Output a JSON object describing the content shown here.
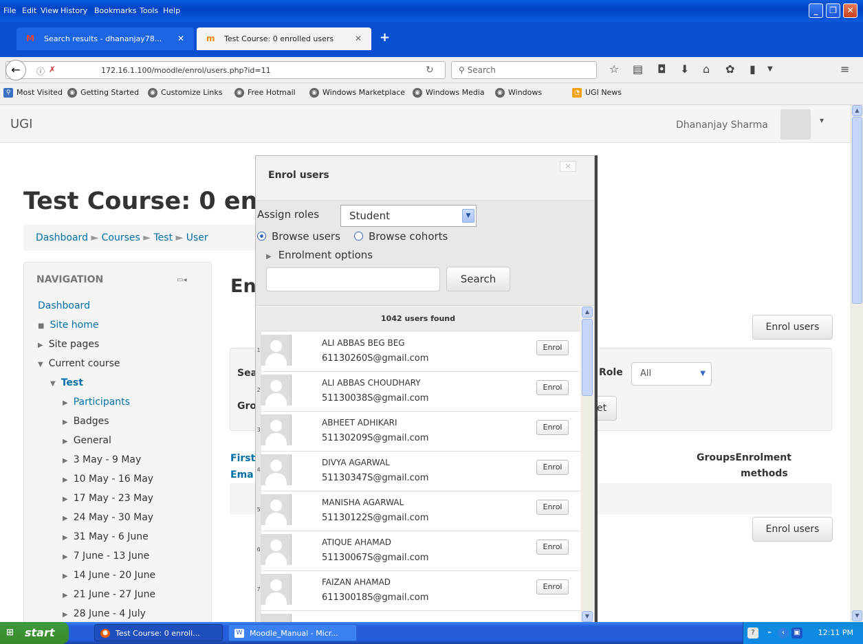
{
  "browser_menu": [
    "File",
    "Edit",
    "View",
    "History",
    "Bookmarks",
    "Tools",
    "Help"
  ],
  "tabs": [
    {
      "label": "Search results - dhananjay78...",
      "icon": "gmail-icon"
    },
    {
      "label": "Test Course: 0 enrolled users",
      "icon": "moodle-icon"
    }
  ],
  "address": {
    "url": "172.16.1.100/moodle/enrol/users.php?id=11",
    "search_placeholder": "Search"
  },
  "bookmarks": [
    "Most Visited",
    "Getting Started",
    "Customize Links",
    "Free Hotmail",
    "Windows Marketplace",
    "Windows Media",
    "Windows",
    "UGI News"
  ],
  "site": {
    "name": "UGI",
    "user": "Dhananjay Sharma"
  },
  "page": {
    "title": "Test Course: 0 enr",
    "breadcrumb": [
      "Dashboard",
      "Courses",
      "Test",
      "User"
    ],
    "heading": "En",
    "enrol_button": "Enrol users",
    "filter_partial_search": "Sea",
    "filter_partial_group": "Gro",
    "role_label": "Role",
    "role_value": "All",
    "reset_partial": "et",
    "col_first": "First",
    "col_email": "Ema",
    "col_groups": "Groups",
    "col_enrolment": "Enrolment",
    "col_methods": "methods"
  },
  "navigation": {
    "heading": "NAVIGATION",
    "dashboard": "Dashboard",
    "site_home": "Site home",
    "site_pages": "Site pages",
    "current_course": "Current course",
    "course": "Test",
    "items": [
      "Participants",
      "Badges",
      "General",
      "3 May - 9 May",
      "10 May - 16 May",
      "17 May - 23 May",
      "24 May - 30 May",
      "31 May - 6 June",
      "7 June - 13 June",
      "14 June - 20 June",
      "21 June - 27 June",
      "28 June - 4 July"
    ]
  },
  "modal": {
    "title": "Enrol users",
    "close": "×",
    "assign_label": "Assign roles",
    "assign_value": "Student",
    "browse_users": "Browse users",
    "browse_cohorts": "Browse cohorts",
    "enrol_options": "Enrolment options",
    "search_button": "Search",
    "found": "1042 users found",
    "enrol_label": "Enrol",
    "users": [
      {
        "n": "1",
        "name": "ALI ABBAS BEG BEG",
        "email": "61130260S@gmail.com"
      },
      {
        "n": "2",
        "name": "ALI ABBAS CHOUDHARY",
        "email": "51130038S@gmail.com"
      },
      {
        "n": "3",
        "name": "ABHEET ADHIKARI",
        "email": "51130209S@gmail.com"
      },
      {
        "n": "4",
        "name": "DIVYA AGARWAL",
        "email": "51130347S@gmail.com"
      },
      {
        "n": "5",
        "name": "MANISHA AGARWAL",
        "email": "51130122S@gmail.com"
      },
      {
        "n": "6",
        "name": "ATIQUE AHAMAD",
        "email": "51130067S@gmail.com"
      },
      {
        "n": "7",
        "name": "FAIZAN AHAMAD",
        "email": "61130018S@gmail.com"
      }
    ]
  },
  "taskbar": {
    "start": "start",
    "tasks": [
      "Test Course: 0 enroll...",
      "Moodle_Manual - Micr..."
    ],
    "clock": "12:11 PM"
  }
}
